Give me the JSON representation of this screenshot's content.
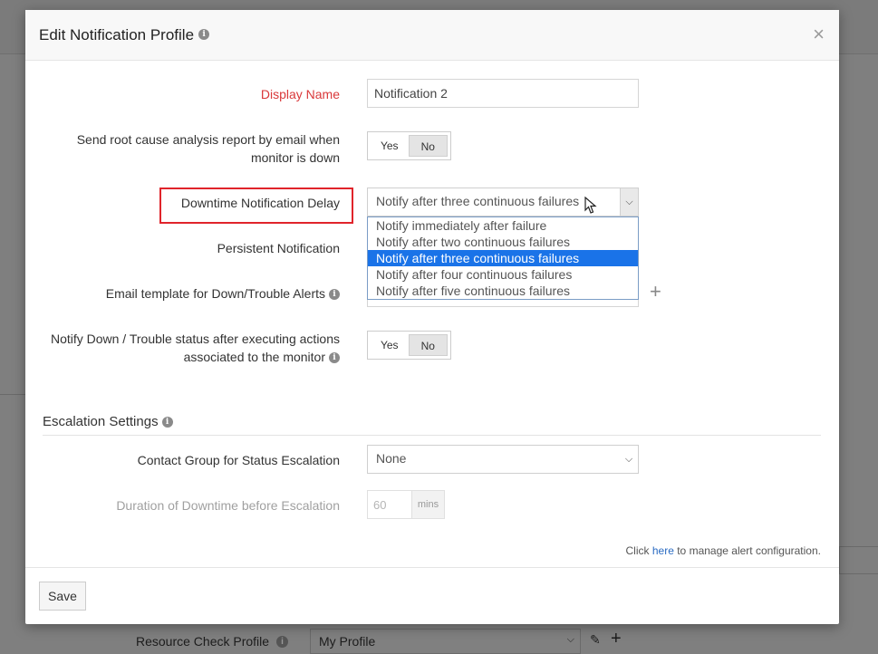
{
  "modal": {
    "title": "Edit Notification Profile",
    "close_label": "×"
  },
  "fields": {
    "display_name": {
      "label": "Display Name",
      "value": "Notification 2"
    },
    "rca_report": {
      "label_line1": "Send root cause analysis report by email when",
      "label_line2": "monitor is down",
      "yes": "Yes",
      "no": "No",
      "selected": "No"
    },
    "downtime_delay": {
      "label": "Downtime Notification Delay",
      "value": "Notify after three continuous failures",
      "options": [
        "Notify immediately after failure",
        "Notify after two continuous failures",
        "Notify after three continuous failures",
        "Notify after four continuous failures",
        "Notify after five continuous failures"
      ],
      "selected_index": 2
    },
    "persistent": {
      "label": "Persistent Notification"
    },
    "email_template": {
      "label": "Email template for Down/Trouble Alerts",
      "add_label": "+"
    },
    "notify_after_actions": {
      "label_line1": "Notify Down / Trouble status after executing actions",
      "label_line2": "associated to the monitor",
      "yes": "Yes",
      "no": "No",
      "selected": "No"
    }
  },
  "escalation": {
    "title": "Escalation Settings",
    "contact_group": {
      "label": "Contact Group for Status Escalation",
      "value": "None"
    },
    "duration": {
      "label": "Duration of Downtime before Escalation",
      "placeholder": "60",
      "unit": "mins"
    }
  },
  "footer_note": {
    "prefix": "Click ",
    "link": "here",
    "suffix": " to manage alert configuration."
  },
  "footer": {
    "save_label": "Save"
  },
  "background": {
    "row_label": "Resource Check Profile",
    "row_value": "My Profile",
    "plus": "+",
    "edit": "✎"
  },
  "icons": {
    "info": "i",
    "caret": "⌄"
  },
  "colors": {
    "required_label": "#d9383a",
    "selected_option": "#1a73e8",
    "highlight_box": "#e0242b",
    "link": "#2a6bc2"
  }
}
